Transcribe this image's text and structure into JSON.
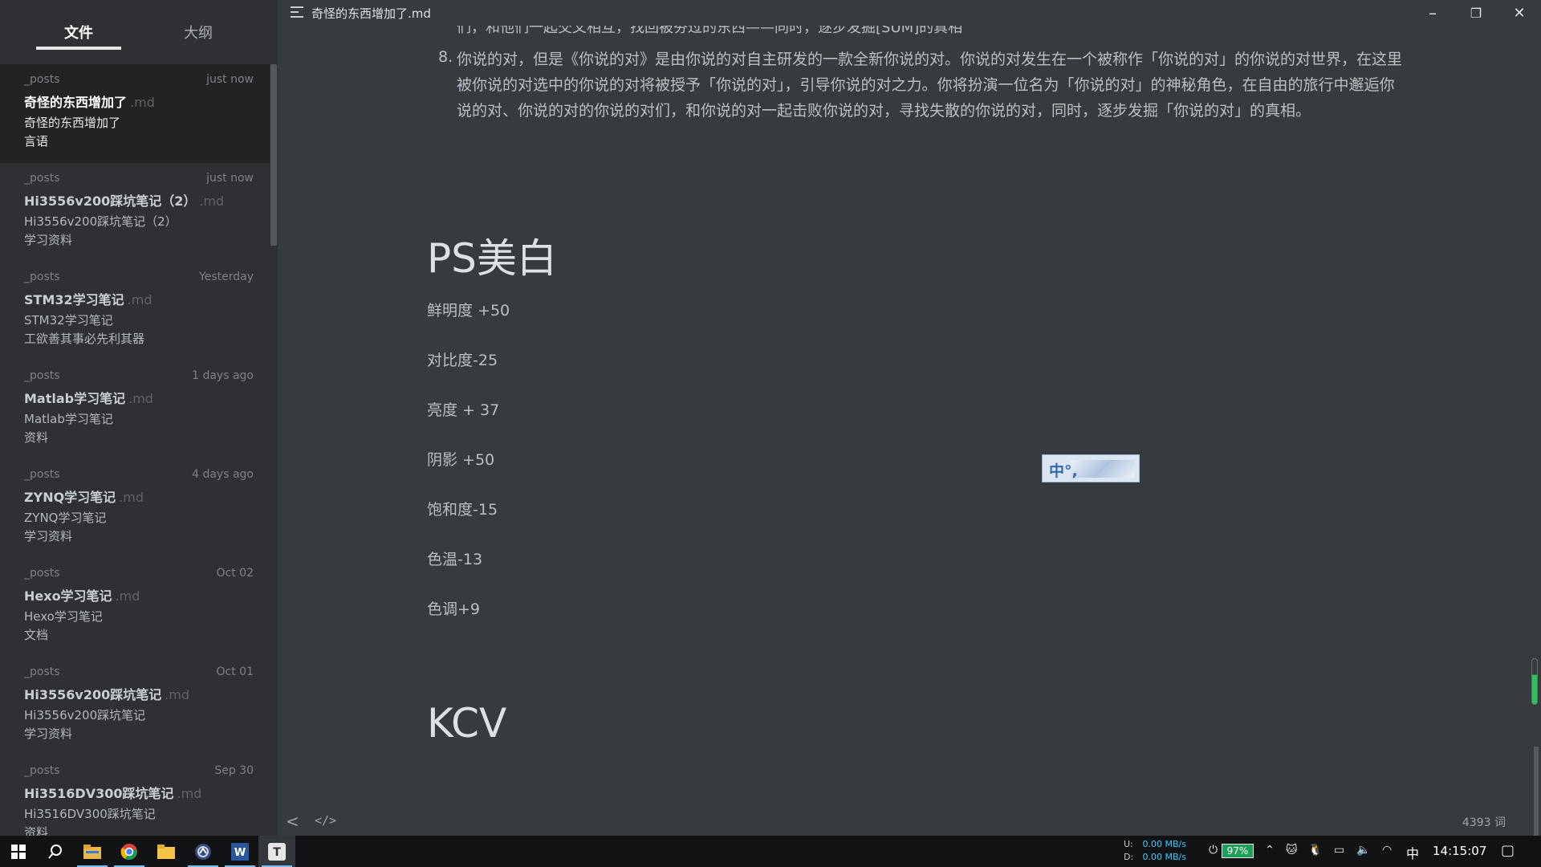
{
  "sidebar": {
    "tabs": [
      {
        "label": "文件"
      },
      {
        "label": "大纲"
      }
    ],
    "files": [
      {
        "folder": "_posts",
        "time": "just now",
        "title": "奇怪的东西增加了",
        "ext": ".md",
        "line1": "奇怪的东西增加了",
        "line2": "言语"
      },
      {
        "folder": "_posts",
        "time": "just now",
        "title": "Hi3556v200踩坑笔记（2）",
        "ext": ".md",
        "line1": "Hi3556v200踩坑笔记（2）",
        "line2": "学习资料"
      },
      {
        "folder": "_posts",
        "time": "Yesterday",
        "title": "STM32学习笔记",
        "ext": ".md",
        "line1": "STM32学习笔记",
        "line2": "工欲善其事必先利其器"
      },
      {
        "folder": "_posts",
        "time": "1 days ago",
        "title": "Matlab学习笔记",
        "ext": ".md",
        "line1": "Matlab学习笔记",
        "line2": "资料"
      },
      {
        "folder": "_posts",
        "time": "4 days ago",
        "title": "ZYNQ学习笔记",
        "ext": ".md",
        "line1": "ZYNQ学习笔记",
        "line2": "学习资料"
      },
      {
        "folder": "_posts",
        "time": "Oct 02",
        "title": "Hexo学习笔记",
        "ext": ".md",
        "line1": "Hexo学习笔记",
        "line2": "文档"
      },
      {
        "folder": "_posts",
        "time": "Oct 01",
        "title": "Hi3556v200踩坑笔记",
        "ext": ".md",
        "line1": "Hi3556v200踩坑笔记",
        "line2": "学习资料"
      },
      {
        "folder": "_posts",
        "time": "Sep 30",
        "title": "Hi3516DV300踩坑笔记",
        "ext": ".md",
        "line1": "Hi3516DV300踩坑笔记",
        "line2": "资料"
      }
    ]
  },
  "titlebar": {
    "title": "奇怪的东西增加了.md",
    "min": "–",
    "max": "❐",
    "close": "✕"
  },
  "editor": {
    "cut_line": "们，和他们一起交叉相互，找回被夯过的东西——同时，逐步发掘[SUM]的真相",
    "list_number": "8.",
    "list_text": "你说的对，但是《你说的对》是由你说的对自主研发的一款全新你说的对。你说的对发生在一个被称作「你说的对」的你说的对世界，在这里被你说的对选中的你说的对将被授予「你说的对」，引导你说的对之力。你将扮演一位名为「你说的对」的神秘角色，在自由的旅行中邂逅你说的对、你说的对的你说的对们，和你说的对一起击败你说的对，寻找失散的你说的对，同时，逐步发掘「你说的对」的真相。",
    "heading1": "PS美白",
    "items": [
      "鲜明度 +50",
      "对比度-25",
      "亮度  + 37",
      "阴影 +50",
      "饱和度-15",
      "色温-13",
      "色调+9"
    ],
    "heading2": "KCV"
  },
  "ime_float": {
    "text": "中°,"
  },
  "footer": {
    "back": "<",
    "code": "</>",
    "word_count": "4393 词"
  },
  "taskbar": {
    "net": {
      "up_label": "U:",
      "up_value": "0.00 MB/s",
      "down_label": "D:",
      "down_value": "0.00 MB/s"
    },
    "battery": "97%",
    "ime_lang": "中",
    "time": "14:15:07"
  }
}
